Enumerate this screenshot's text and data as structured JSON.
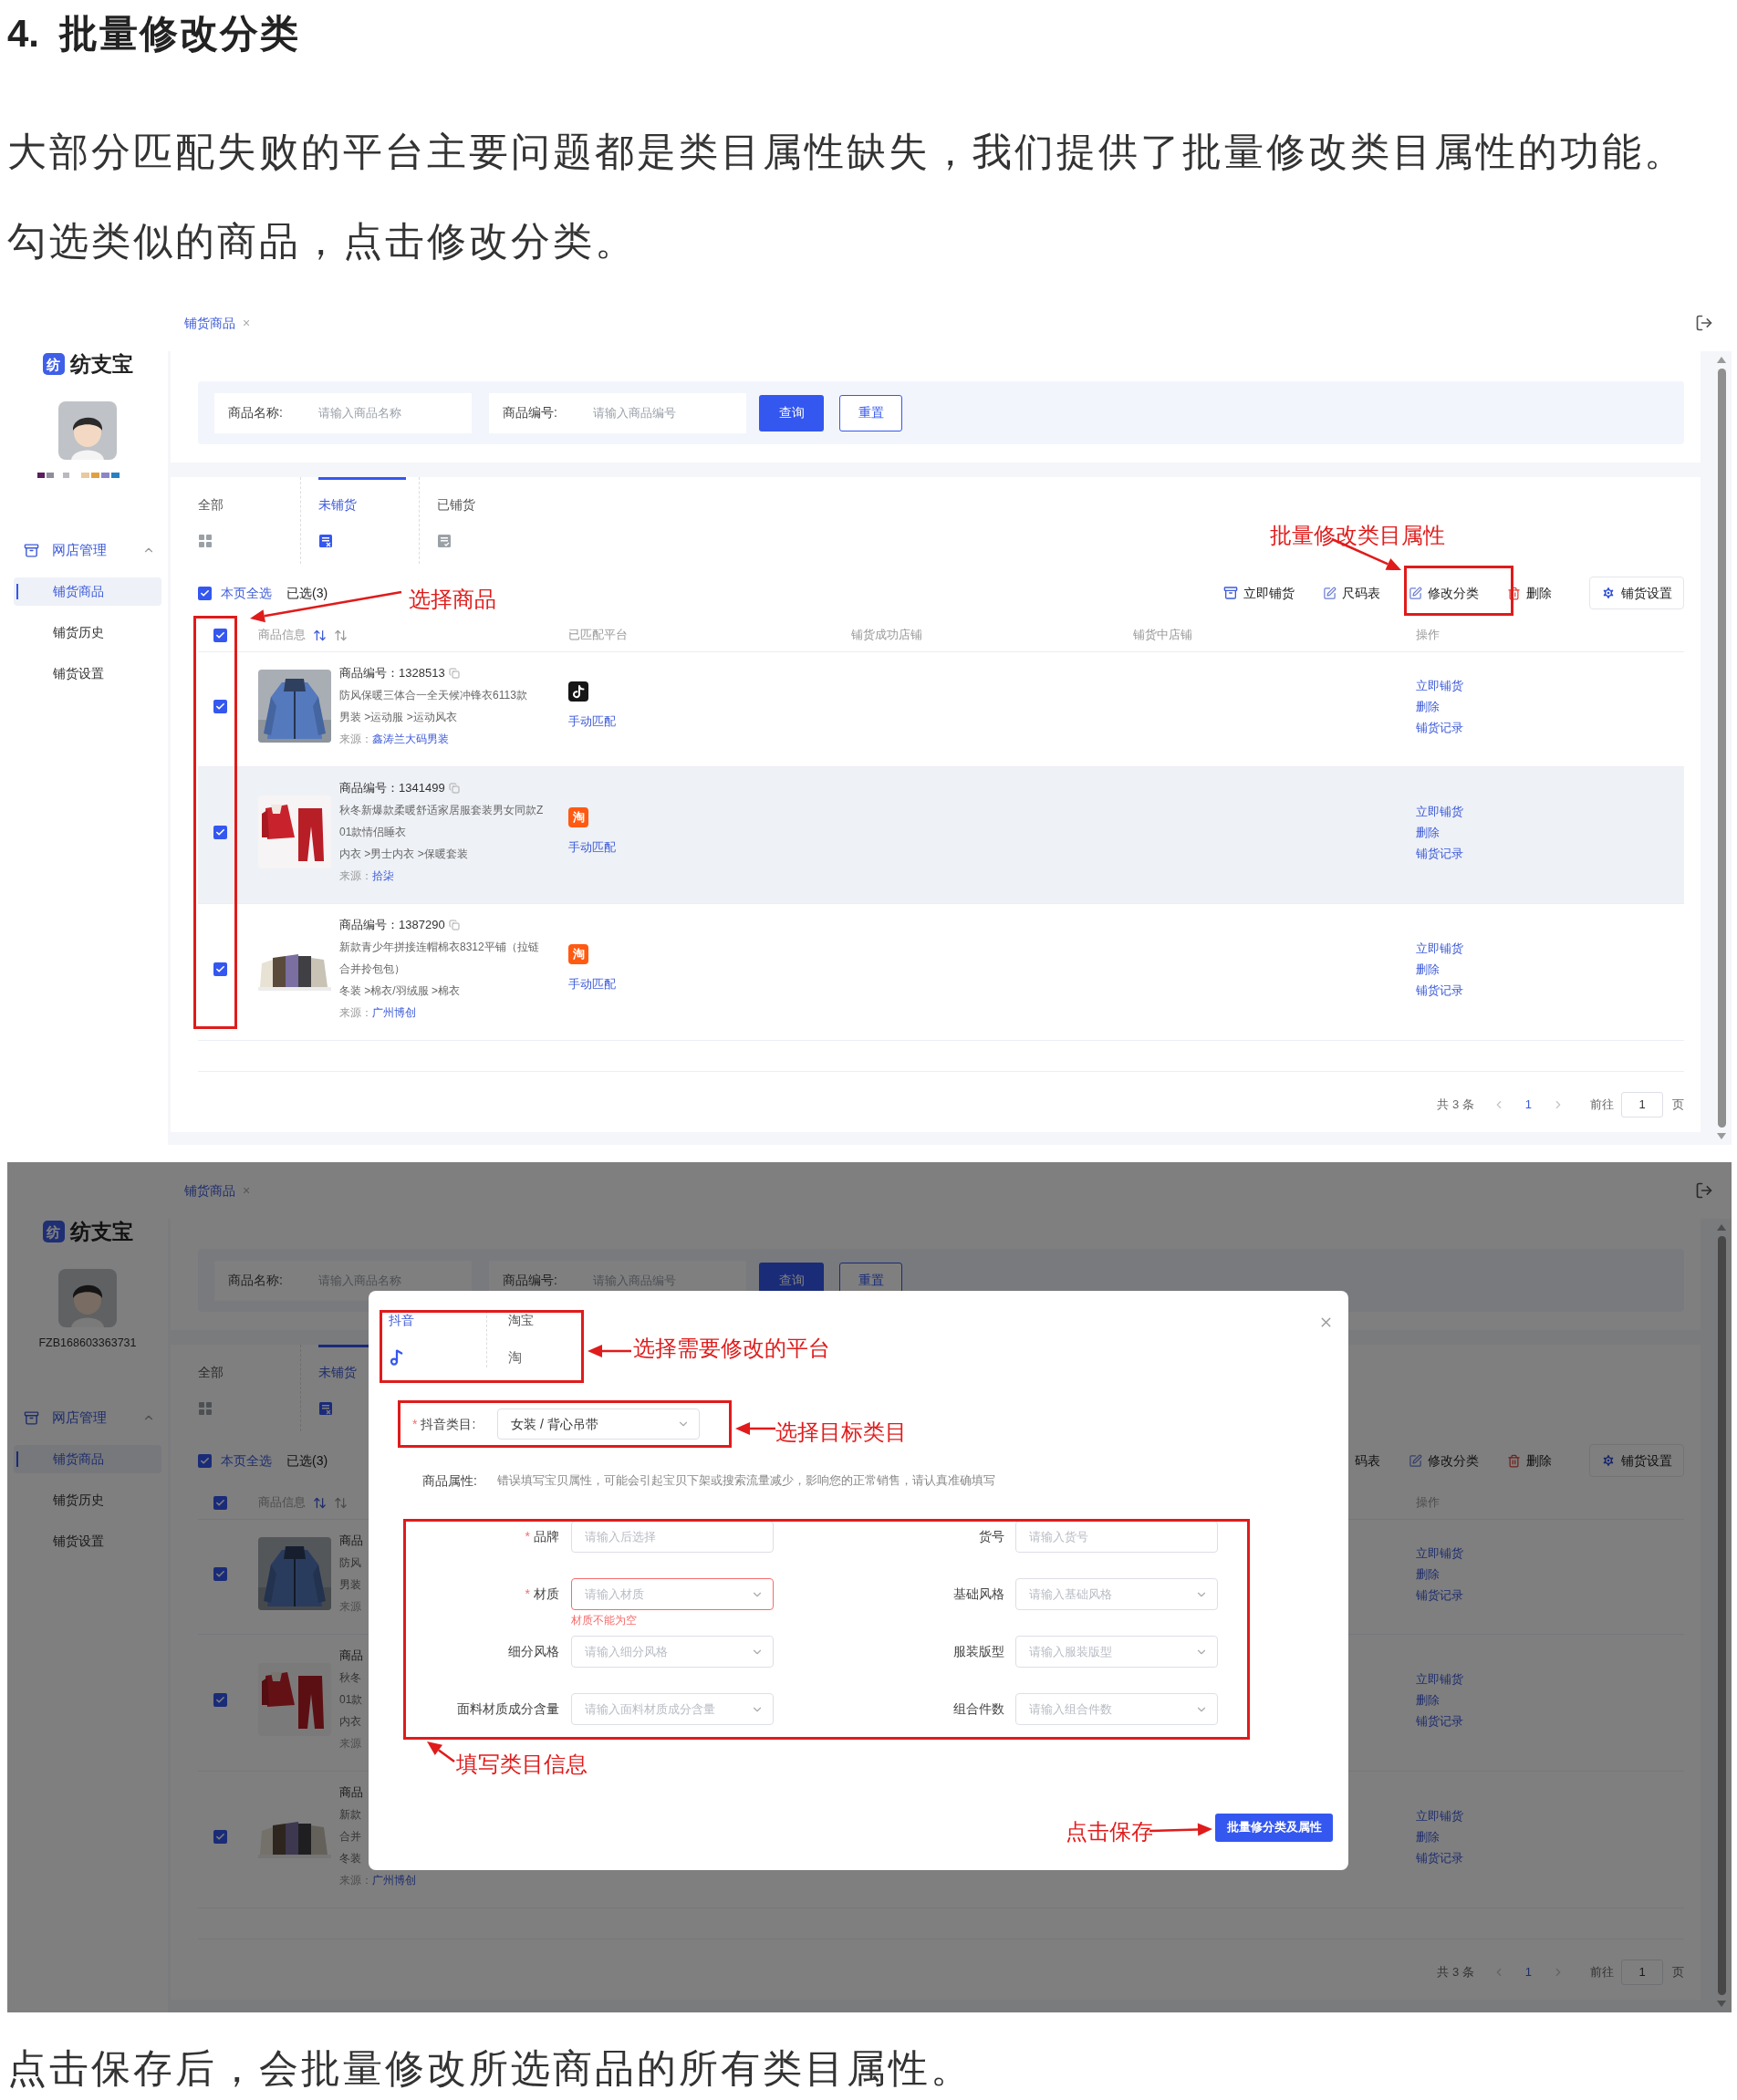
{
  "heading": {
    "number": "4.",
    "title": "批量修改分类"
  },
  "paragraphs": [
    "大部分匹配失败的平台主要问题都是类目属性缺失，我们提供了批量修改类目属性的功能。",
    "勾选类似的商品，点击修改分类。"
  ],
  "screenshots": [
    {
      "dimmed": false,
      "page_tab": {
        "label": "铺货商品",
        "close": "×"
      },
      "sidebar": {
        "logo_mark": "纺",
        "logo_text": "纺支宝",
        "redacted": true,
        "menu": {
          "label": "网店管理",
          "expanded": true,
          "items": [
            {
              "label": "铺货商品",
              "selected": true
            },
            {
              "label": "铺货历史",
              "selected": false
            },
            {
              "label": "铺货设置",
              "selected": false
            }
          ]
        }
      },
      "search": {
        "fields": [
          {
            "label": "商品名称:",
            "placeholder": "请输入商品名称"
          },
          {
            "label": "商品编号:",
            "placeholder": "请输入商品编号"
          }
        ],
        "buttons": [
          {
            "label": "查询",
            "kind": "primary"
          },
          {
            "label": "重置",
            "kind": "outline"
          }
        ]
      },
      "status_tabs": [
        {
          "label": "全部",
          "kind": "all",
          "selected": false
        },
        {
          "label": "未铺货",
          "kind": "pending",
          "selected": true
        },
        {
          "label": "已铺货",
          "kind": "done",
          "selected": false
        }
      ],
      "select_all": {
        "label": "本页全选",
        "checked": true
      },
      "selected_count": "已选(3)",
      "toolbar": [
        {
          "label": "立即铺货",
          "kind": "stock"
        },
        {
          "label": "尺码表",
          "kind": "size"
        },
        {
          "label": "修改分类",
          "kind": "edit"
        },
        {
          "label": "删除",
          "kind": "delete"
        },
        {
          "label": "铺货设置",
          "kind": "settings"
        }
      ],
      "table": {
        "header_checked": true,
        "info_header": "商品信息",
        "middle_headers": [
          "已匹配平台",
          "铺货成功店铺",
          "铺货中店铺"
        ],
        "action_header": "操作",
        "rows": [
          {
            "checked": true,
            "highlighted": false,
            "code": "商品编号：1328513",
            "title_lines": [
              "防风保暖三体合一全天候冲锋衣6113款"
            ],
            "category": "男装 >运动服 >运动风衣",
            "source_label": "来源：",
            "source": "鑫涛兰大码男装",
            "platform": {
              "kind": "douyin",
              "action": "手动匹配"
            },
            "actions": [
              "立即铺货",
              "删除",
              "铺货记录"
            ]
          },
          {
            "checked": true,
            "highlighted": true,
            "code": "商品编号：1341499",
            "title_lines": [
              "秋冬新爆款柔暖舒适家居服套装男女同款Z",
              "01款情侣睡衣"
            ],
            "category": "内衣 >男士内衣 >保暖套装",
            "source_label": "来源：",
            "source": "拾柒",
            "platform": {
              "kind": "taobao",
              "badge": "淘",
              "action": "手动匹配"
            },
            "actions": [
              "立即铺货",
              "删除",
              "铺货记录"
            ]
          },
          {
            "checked": true,
            "highlighted": false,
            "code": "商品编号：1387290",
            "title_lines": [
              "新款青少年拼接连帽棉衣8312平铺（拉链",
              "合并拎包包）"
            ],
            "category": "冬装 >棉衣/羽绒服 >棉衣",
            "source_label": "来源：",
            "source": "广州博创",
            "platform": {
              "kind": "taobao",
              "badge": "淘",
              "action": "手动匹配"
            },
            "actions": [
              "立即铺货",
              "删除",
              "铺货记录"
            ]
          }
        ]
      },
      "pagination": {
        "total": "共 3 条",
        "pages": [
          {
            "label": "1",
            "selected": true
          }
        ],
        "goto_label": "前往",
        "goto_value": "1",
        "goto_suffix": "页"
      },
      "annotations": [
        {
          "text": "选择商品"
        },
        {
          "text": "批量修改类目属性"
        }
      ]
    },
    {
      "dimmed": true,
      "page_tab": {
        "label": "铺货商品",
        "close": "×"
      },
      "sidebar": {
        "logo_mark": "纺",
        "logo_text": "纺支宝",
        "user_id": "FZB168603363731",
        "menu": {
          "label": "网店管理",
          "expanded": true,
          "items": [
            {
              "label": "铺货商品",
              "selected": true
            },
            {
              "label": "铺货历史",
              "selected": false
            },
            {
              "label": "铺货设置",
              "selected": false
            }
          ]
        }
      },
      "search": {
        "fields": [
          {
            "label": "商品名称:",
            "placeholder": "请输入商品名称"
          },
          {
            "label": "商品编号:",
            "placeholder": "请输入商品编号"
          }
        ],
        "buttons": [
          {
            "label": "查询",
            "kind": "primary"
          },
          {
            "label": "重置",
            "kind": "outline"
          }
        ]
      },
      "status_tabs": [
        {
          "label": "全部",
          "kind": "all",
          "selected": false
        },
        {
          "label": "未铺货",
          "kind": "pending",
          "selected": true
        }
      ],
      "select_all": {
        "label": "本页全选",
        "checked": true
      },
      "selected_count": "已选(3)",
      "toolbar": [
        {
          "label": "码表",
          "kind": "text"
        },
        {
          "label": "修改分类",
          "kind": "edit"
        },
        {
          "label": "删除",
          "kind": "delete"
        },
        {
          "label": "铺货设置",
          "kind": "settings"
        }
      ],
      "table": {
        "header_checked": true,
        "info_header": "商品信息",
        "action_header": "操作",
        "rows": [
          {
            "checked": true,
            "code": "商品",
            "title_lines": [
              "防风"
            ],
            "category": "男装",
            "source_label": "来源",
            "actions": [
              "立即铺货",
              "删除",
              "铺货记录"
            ]
          },
          {
            "checked": true,
            "code": "商品",
            "title_lines": [
              "秋冬",
              "01款"
            ],
            "category": "内衣",
            "source_label": "来源",
            "actions": [
              "立即铺货",
              "删除",
              "铺货记录"
            ]
          },
          {
            "checked": true,
            "code": "商品",
            "title_lines": [
              "新款",
              "合并"
            ],
            "category": "冬装",
            "source_label": "来源：",
            "source": "广州博创",
            "actions": [
              "立即铺货",
              "删除",
              "铺货记录"
            ]
          }
        ]
      },
      "pagination": {
        "total": "共 3 条",
        "pages": [
          {
            "label": "1",
            "selected": true
          }
        ],
        "goto_label": "前往",
        "goto_value": "1",
        "goto_suffix": "页"
      },
      "modal": {
        "platform_tabs": [
          {
            "label": "抖音",
            "kind": "douyin",
            "selected": true
          },
          {
            "label": "淘宝",
            "kind": "taobao",
            "badge": "淘",
            "selected": false
          }
        ],
        "category": {
          "required_mark": "*",
          "label": "抖音类目:",
          "value": "女装 / 背心吊带"
        },
        "attributes": {
          "label": "商品属性:",
          "note": "错误填写宝贝属性，可能会引起宝贝下架或搜索流量减少，影响您的正常销售，请认真准确填写"
        },
        "fields": [
          {
            "label": "品牌",
            "required_mark": "*",
            "kind": "input",
            "placeholder": "请输入后选择"
          },
          {
            "label": "货号",
            "kind": "input",
            "placeholder": "请输入货号"
          },
          {
            "label": "材质",
            "required_mark": "*",
            "kind": "select",
            "placeholder": "请输入材质",
            "error": "材质不能为空"
          },
          {
            "label": "基础风格",
            "kind": "select",
            "placeholder": "请输入基础风格"
          },
          {
            "label": "细分风格",
            "kind": "select",
            "placeholder": "请输入细分风格"
          },
          {
            "label": "服装版型",
            "kind": "select",
            "placeholder": "请输入服装版型"
          },
          {
            "label": "面料材质成分含量",
            "kind": "select",
            "placeholder": "请输入面料材质成分含量"
          },
          {
            "label": "组合件数",
            "kind": "select",
            "placeholder": "请输入组合件数"
          }
        ],
        "save": "批量修分类及属性",
        "annotations": [
          {
            "text": "选择需要修改的平台"
          },
          {
            "text": "选择目标类目"
          },
          {
            "text": "填写类目信息"
          },
          {
            "text": "点击保存"
          }
        ]
      }
    }
  ],
  "closing": "点击保存后，会批量修改所选商品的所有类目属性。"
}
